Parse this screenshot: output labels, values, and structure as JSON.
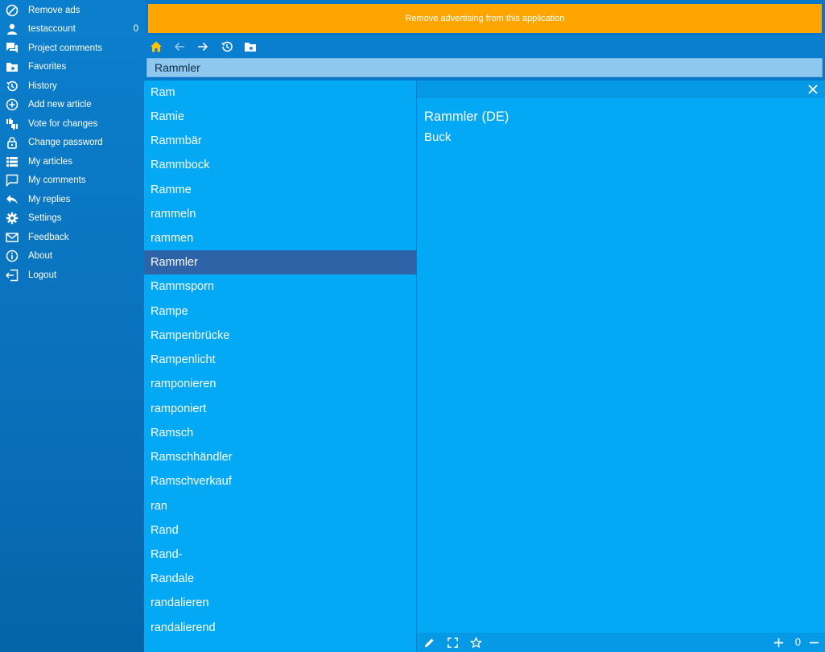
{
  "sidebar": {
    "items": [
      {
        "label": "Remove ads",
        "icon": "block-icon"
      },
      {
        "label": "testaccount",
        "icon": "user-icon",
        "count": "0"
      },
      {
        "label": "Project comments",
        "icon": "chat-icon"
      },
      {
        "label": "Favorites",
        "icon": "favorites-folder-icon"
      },
      {
        "label": "History",
        "icon": "history-icon"
      },
      {
        "label": "Add new article",
        "icon": "add-circle-icon"
      },
      {
        "label": "Vote for changes",
        "icon": "vote-icon"
      },
      {
        "label": "Change password",
        "icon": "lock-icon"
      },
      {
        "label": "My articles",
        "icon": "list-icon"
      },
      {
        "label": "My comments",
        "icon": "comment-icon"
      },
      {
        "label": "My replies",
        "icon": "reply-icon"
      },
      {
        "label": "Settings",
        "icon": "gear-icon"
      },
      {
        "label": "Feedback",
        "icon": "mail-icon"
      },
      {
        "label": "About",
        "icon": "info-icon"
      },
      {
        "label": "Logout",
        "icon": "logout-icon"
      }
    ]
  },
  "ad_banner": {
    "text": "Remove advertising from this application"
  },
  "search": {
    "value": "Rammler"
  },
  "word_list": {
    "items": [
      "Ram",
      "Ramie",
      "Rammbär",
      "Rammbock",
      "Ramme",
      "rammeln",
      "rammen",
      "Rammler",
      "Rammsporn",
      "Rampe",
      "Rampenbrücke",
      "Rampenlicht",
      "ramponieren",
      "ramponiert",
      "Ramsch",
      "Ramschhändler",
      "Ramschverkauf",
      "ran",
      "Rand",
      "Rand-",
      "Randale",
      "randalieren",
      "randalierend"
    ],
    "selected": "Rammler"
  },
  "entry": {
    "title": "Rammler (DE)",
    "translation": "Buck"
  },
  "footer": {
    "zoom": "0"
  },
  "colors": {
    "accent": "#ffa500",
    "list_bg": "#03a9f4",
    "selected_bg": "#2e63a8",
    "home_icon": "#ffc107"
  }
}
